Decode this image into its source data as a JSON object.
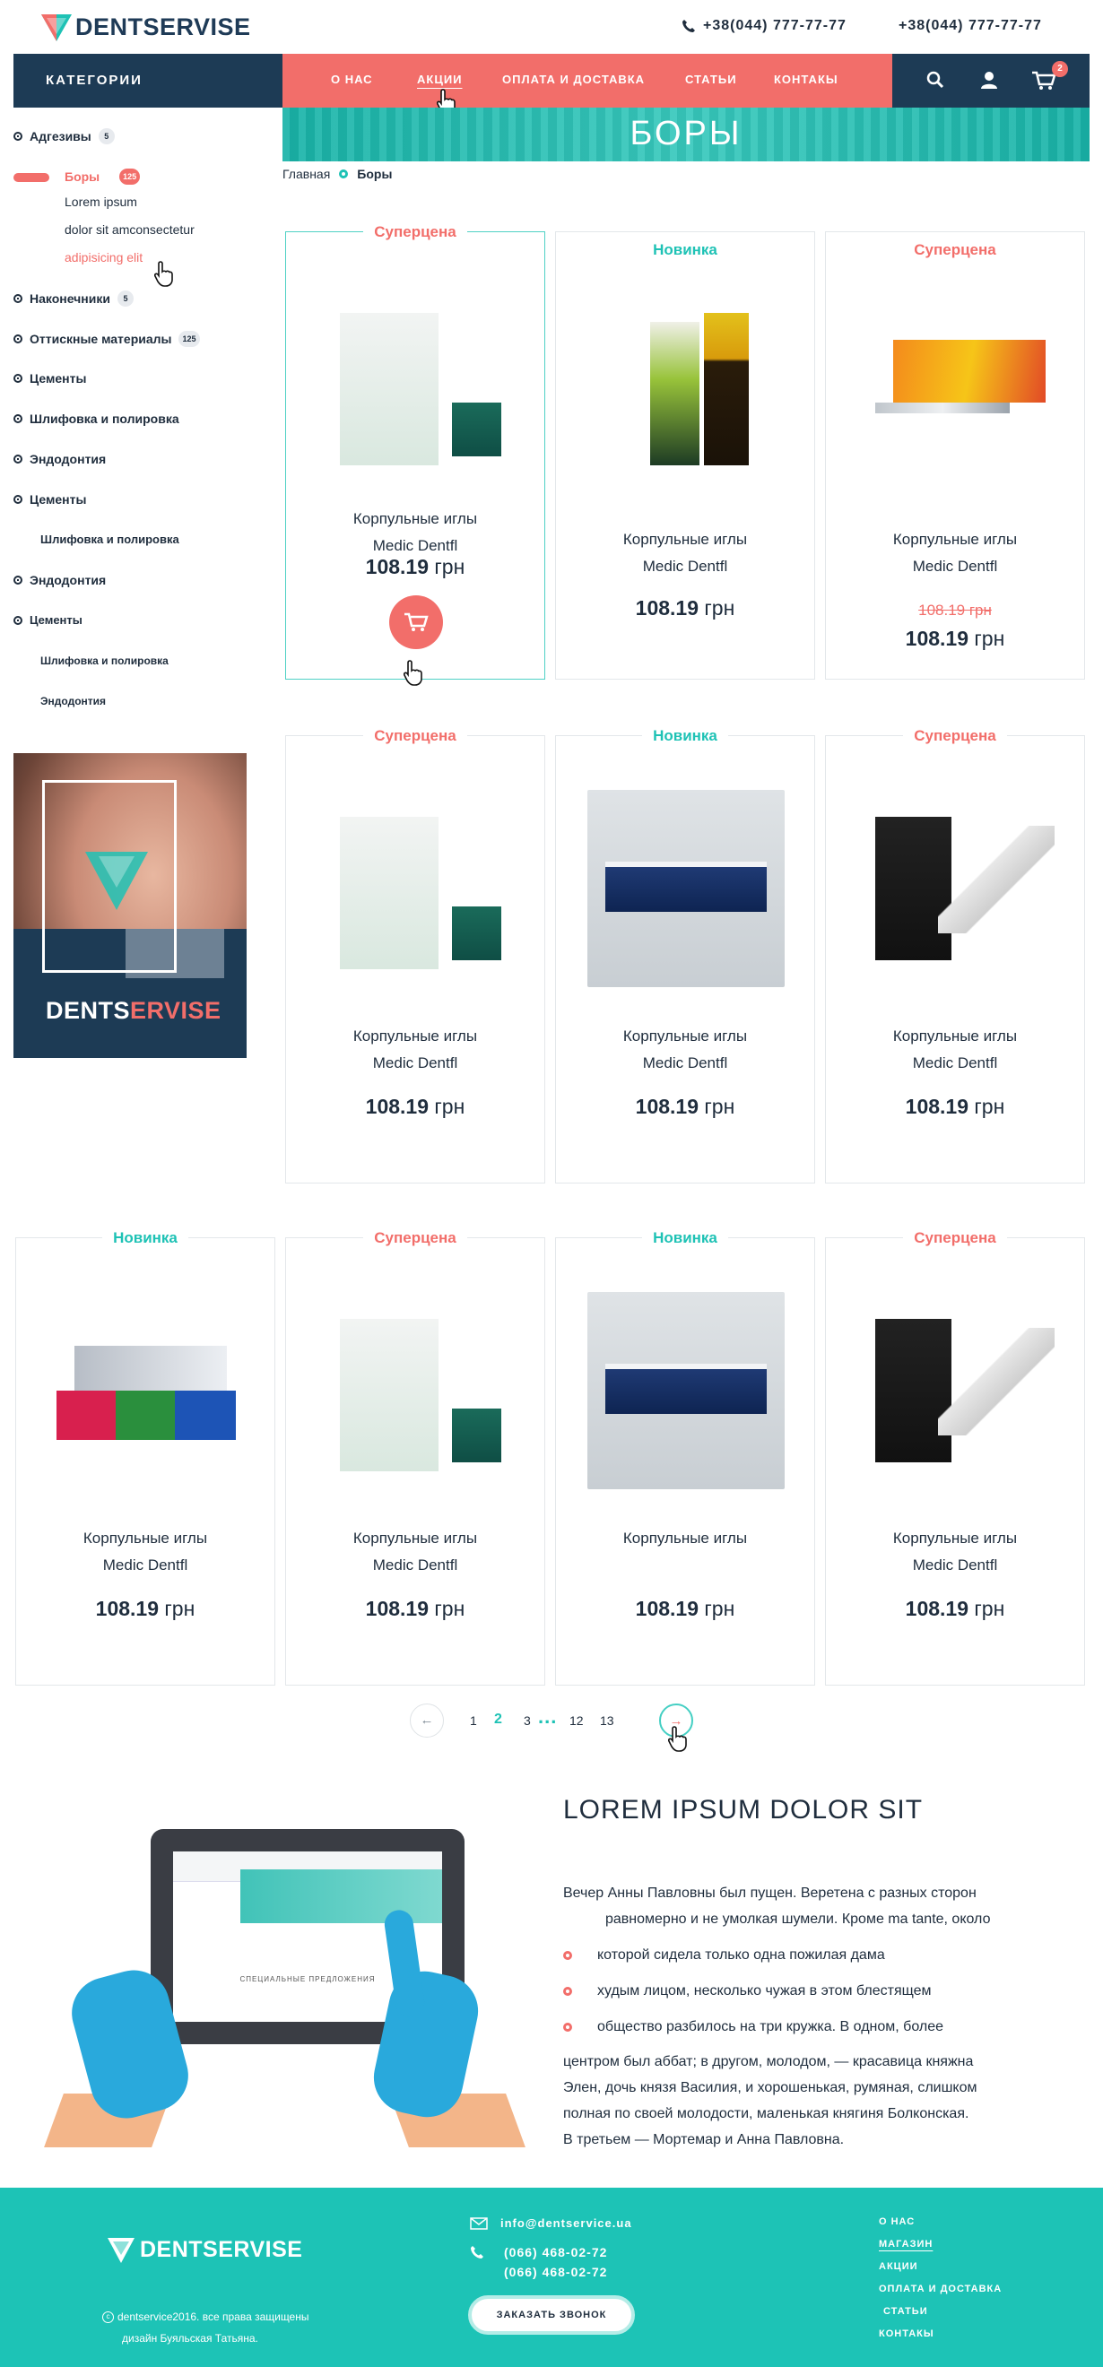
{
  "header": {
    "brand": "DENTSERVISE",
    "phones": [
      "+38(044) 777-77-77",
      "+38(044) 777-77-77"
    ]
  },
  "nav": {
    "categories_label": "КАТЕГОРИИ",
    "menu": [
      {
        "label": "О НАС",
        "active": false
      },
      {
        "label": "АКЦИИ",
        "active": true
      },
      {
        "label": "ОПЛАТА И ДОСТАВКА",
        "active": false
      },
      {
        "label": "СТАТЬИ",
        "active": false
      },
      {
        "label": "КОНТАКЫ",
        "active": false
      }
    ],
    "icons": [
      "search-icon",
      "user-icon",
      "cart-icon"
    ],
    "cart_count": "2"
  },
  "banner": {
    "title": "БОРЫ"
  },
  "breadcrumb": {
    "home": "Главная",
    "current": "Боры"
  },
  "sidebar": {
    "categories": [
      {
        "label": "Адгезивы",
        "badge": "5"
      },
      {
        "label": "Боры",
        "badge": "125",
        "active": true
      },
      {
        "label": "Наконечники",
        "badge": "5"
      },
      {
        "label": "Оттискные материалы",
        "badge": "125"
      },
      {
        "label": "Цементы"
      },
      {
        "label": "Шлифовка и полировка"
      },
      {
        "label": "Эндодонтия"
      },
      {
        "label": "Цементы"
      },
      {
        "label": "Эндодонтия"
      },
      {
        "label": "Цементы"
      }
    ],
    "subitems": [
      "Lorem ipsum",
      "dolor sit amconsectetur",
      "adipisicing elit"
    ],
    "plain_items": [
      "Шлифовка и полировка",
      "Шлифовка и полировка",
      "Эндодонтия"
    ],
    "promo_brand_a": "DENTS",
    "promo_brand_b": "ERVISE"
  },
  "products": [
    {
      "label": "Суперцена",
      "label_type": "sale",
      "name1": "Корпульные иглы",
      "name2": "Medic Dentfl",
      "price": "108.19",
      "currency": "грн",
      "image": "izumrud-bottle"
    },
    {
      "label": "Новинка",
      "label_type": "new",
      "name1": "Корпульные иглы",
      "name2": "Medic Dentfl",
      "price": "108.19",
      "currency": "грн",
      "image": "endo-kit"
    },
    {
      "label": "Суперцена",
      "label_type": "sale",
      "name1": "Корпульные иглы",
      "name2": "Medic Dentfl",
      "price": "108.19",
      "old_price": "108.19 грн",
      "currency": "грн",
      "image": "syringe-pack"
    },
    {
      "label": "Суперцена",
      "label_type": "sale",
      "name1": "Корпульные иглы",
      "name2": "Medic Dentfl",
      "price": "108.19",
      "currency": "грн",
      "image": "izumrud-bottle"
    },
    {
      "label": "Новинка",
      "label_type": "new",
      "name1": "Корпульные иглы",
      "name2": "Medic Dentfl",
      "price": "108.19",
      "currency": "грн",
      "image": "handpiece-box"
    },
    {
      "label": "Суперцена",
      "label_type": "sale",
      "name1": "Корпульные иглы",
      "name2": "Medic Dentfl",
      "price": "108.19",
      "currency": "грн",
      "image": "interlig"
    },
    {
      "label": "Новинка",
      "label_type": "new",
      "name1": "Корпульные иглы",
      "name2": "Medic Dentfl",
      "price": "108.19",
      "currency": "грн",
      "image": "x-ject"
    },
    {
      "label": "Суперцена",
      "label_type": "sale",
      "name1": "Корпульные иглы",
      "name2": "Medic Dentfl",
      "price": "108.19",
      "currency": "грн",
      "image": "izumrud-bottle"
    },
    {
      "label": "Новинка",
      "label_type": "new",
      "name1": "Корпульные иглы",
      "name2": "",
      "price": "108.19",
      "currency": "грн",
      "image": "handpiece-box"
    },
    {
      "label": "Суперцена",
      "label_type": "sale",
      "name1": "Корпульные иглы",
      "name2": "Medic Dentfl",
      "price": "108.19",
      "currency": "грн",
      "image": "interlig"
    }
  ],
  "pagination": {
    "pages": [
      "1",
      "2",
      "3",
      "...",
      "12",
      "13"
    ],
    "current": "2"
  },
  "info": {
    "title": "LOREM IPSUM DOLOR SIT",
    "intro1": "Вечер Анны Павловны был пущен. Веретена с разных сторон",
    "intro2": "равномерно и не умолкая шумели. Кроме ma tante, около",
    "bullets": [
      "которой сидела только одна пожилая дама",
      "худым лицом, несколько чужая в этом блестящем",
      "общество разбилось на три кружка. В одном, более"
    ],
    "outro": [
      "центром был аббат; в другом, молодом, — красавица княжна",
      "Элен, дочь князя Василия, и хорошенькая, румяная, слишком",
      "полная по своей молодости, маленькая княгиня Болконская.",
      "В третьем — Мортемар и Анна Павловна."
    ],
    "tablet_section": "СПЕЦИАЛЬНЫЕ ПРЕДЛОЖЕНИЯ"
  },
  "footer": {
    "brand": "DENTSERVISE",
    "copyright": "dentservice2016. все права защищены",
    "designer": "дизайн Буяльская Татьяна.",
    "email": "info@dentservice.ua",
    "phones": [
      "(066) 468-02-72",
      "(066) 468-02-72"
    ],
    "call_button": "ЗАКАЗАТЬ ЗВОНОК",
    "nav": [
      {
        "label": "О НАС",
        "active": false
      },
      {
        "label": "МАГАЗИН",
        "active": true
      },
      {
        "label": "АКЦИИ",
        "active": false
      },
      {
        "label": "ОПЛАТА И ДОСТАВКА",
        "active": false
      },
      {
        "label": "СТАТЬИ",
        "active": false
      },
      {
        "label": "КОНТАКЫ",
        "active": false
      }
    ]
  },
  "colors": {
    "accent": "#f26e6a",
    "teal": "#1ec2b5",
    "navy": "#1d3b55"
  }
}
